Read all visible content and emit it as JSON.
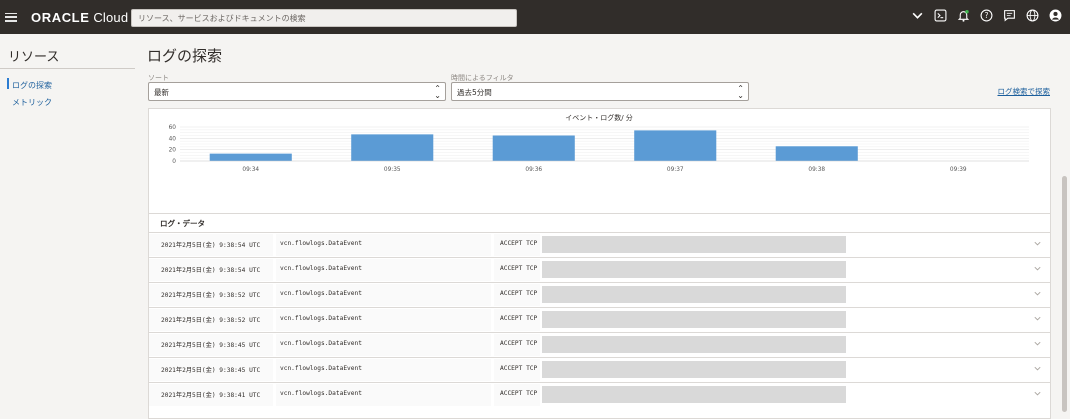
{
  "header": {
    "logo_brand": "ORACLE",
    "logo_product": "Cloud",
    "search_placeholder": "リソース、サービスおよびドキュメントの検索",
    "icons": [
      "chevron-down-icon",
      "cloud-shell-icon",
      "notification-bell-icon",
      "help-icon",
      "chat-icon",
      "globe-icon",
      "user-icon"
    ]
  },
  "sidebar": {
    "title": "リソース",
    "items": [
      {
        "label": "ログの探索",
        "active": true
      },
      {
        "label": "メトリック",
        "active": false
      }
    ]
  },
  "main": {
    "title": "ログの探索",
    "sort": {
      "label": "ソート",
      "value": "最新"
    },
    "time_filter": {
      "label": "時間によるフィルタ",
      "value": "過去5分間"
    },
    "search_link": "ログ検索で探索",
    "log_data_title": "ログ・データ"
  },
  "chart_data": {
    "type": "bar",
    "title": "イベント・ログ数/ 分",
    "categories": [
      "09:34",
      "09:35",
      "09:36",
      "09:37",
      "09:38",
      "09:39"
    ],
    "values": [
      13,
      47,
      45,
      54,
      26,
      0
    ],
    "y_ticks": [
      0,
      20,
      40,
      60
    ],
    "ylim": [
      0,
      60
    ],
    "grid": true,
    "bar_color": "#5b9bd5"
  },
  "log_rows": [
    {
      "time": "2021年2月5日(金) 9:38:54 UTC",
      "source": "vcn.flowlogs.DataEvent",
      "action": "ACCEPT TCP"
    },
    {
      "time": "2021年2月5日(金) 9:38:54 UTC",
      "source": "vcn.flowlogs.DataEvent",
      "action": "ACCEPT TCP"
    },
    {
      "time": "2021年2月5日(金) 9:38:52 UTC",
      "source": "vcn.flowlogs.DataEvent",
      "action": "ACCEPT TCP"
    },
    {
      "time": "2021年2月5日(金) 9:38:52 UTC",
      "source": "vcn.flowlogs.DataEvent",
      "action": "ACCEPT TCP"
    },
    {
      "time": "2021年2月5日(金) 9:38:45 UTC",
      "source": "vcn.flowlogs.DataEvent",
      "action": "ACCEPT TCP"
    },
    {
      "time": "2021年2月5日(金) 9:38:45 UTC",
      "source": "vcn.flowlogs.DataEvent",
      "action": "ACCEPT TCP"
    },
    {
      "time": "2021年2月5日(金) 9:38:41 UTC",
      "source": "vcn.flowlogs.DataEvent",
      "action": "ACCEPT TCP"
    }
  ]
}
